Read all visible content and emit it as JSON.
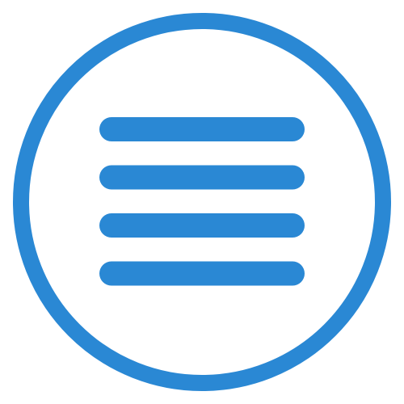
{
  "menu_button": {
    "icon": "hamburger-menu-icon",
    "line_count": 4,
    "colors": {
      "accent": "#2a88d4",
      "background": "#ffffff"
    }
  }
}
